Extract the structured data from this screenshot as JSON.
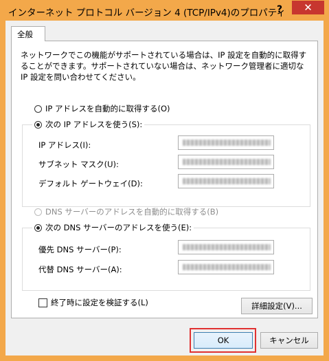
{
  "window": {
    "title": "インターネット プロトコル バージョン 4 (TCP/IPv4)のプロパティ",
    "help": "?",
    "close": "✕"
  },
  "tab": {
    "label": "全般"
  },
  "description": "ネットワークでこの機能がサポートされている場合は、IP 設定を自動的に取得することができます。サポートされていない場合は、ネットワーク管理者に適切な IP 設定を問い合わせてください。",
  "ip_section": {
    "auto_label": "IP アドレスを自動的に取得する(O)",
    "manual_label": "次の IP アドレスを使う(S):",
    "fields": [
      {
        "label": "IP アドレス(I):"
      },
      {
        "label": "サブネット マスク(U):"
      },
      {
        "label": "デフォルト ゲートウェイ(D):"
      }
    ]
  },
  "dns_section": {
    "auto_label": "DNS サーバーのアドレスを自動的に取得する(B)",
    "manual_label": "次の DNS サーバーのアドレスを使う(E):",
    "fields": [
      {
        "label": "優先 DNS サーバー(P):"
      },
      {
        "label": "代替 DNS サーバー(A):"
      }
    ]
  },
  "validate_label": "終了時に設定を検証する(L)",
  "advanced_button": "詳細設定(V)...",
  "ok_button": "OK",
  "cancel_button": "キャンセル"
}
